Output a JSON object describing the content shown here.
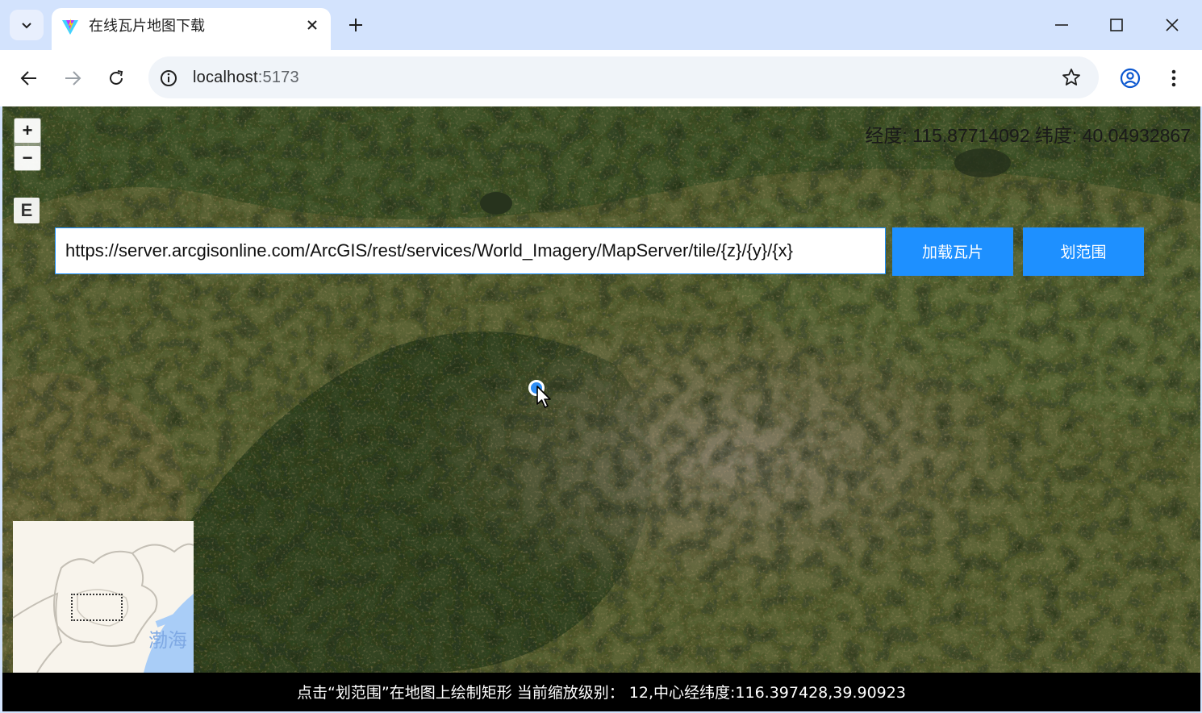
{
  "browser": {
    "tab_title": "在线瓦片地图下载",
    "url_host": "localhost",
    "url_port": ":5173"
  },
  "map": {
    "mouse_position": "经度: 115.87714092 纬度: 40.04932867",
    "zoom_in_label": "+",
    "zoom_out_label": "−",
    "zoom_extent_label": "E",
    "tile_url": "https://server.arcgisonline.com/ArcGIS/rest/services/World_Imagery/MapServer/tile/{z}/{y}/{x}",
    "load_tiles_label": "加载瓦片",
    "draw_extent_label": "划范围",
    "overview_label": "渤海"
  },
  "status": {
    "text": "点击“划范围”在地图上绘制矩形 当前缩放级别： 12,中心经纬度:116.397428,39.90923"
  },
  "colors": {
    "accent": "#1e90ff",
    "tabbar": "#d3e3fd",
    "marker": "#2f8ef5"
  }
}
